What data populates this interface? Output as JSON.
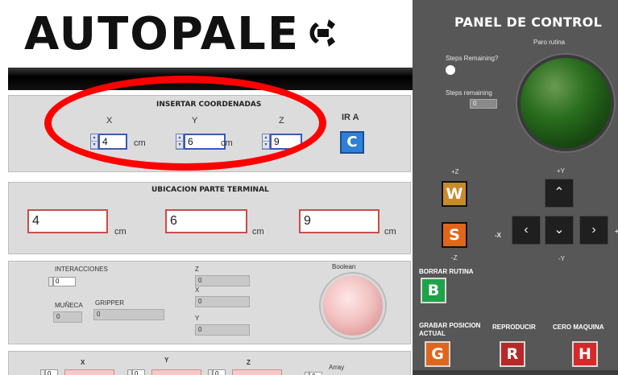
{
  "logo": {
    "text": "AUTOPALE",
    "icon": "gripper-icon"
  },
  "insert_panel": {
    "title": "INSERTAR COORDENADAS",
    "x_label": "X",
    "y_label": "Y",
    "z_label": "Z",
    "x_value": "4",
    "y_value": "6",
    "z_value": "9",
    "unit": "cm",
    "go_label": "IR A",
    "go_button": "C"
  },
  "terminal_panel": {
    "title": "UBICACION PARTE TERMINAL",
    "x_value": "4",
    "y_value": "6",
    "z_value": "9",
    "unit": "cm"
  },
  "status_panel": {
    "interacciones_label": "INTERACCIONES",
    "interacciones_value": "0",
    "muneca_label": "MUÑECA",
    "muneca_value": "0",
    "gripper_label": "GRIPPER",
    "gripper_value": "0",
    "z_label": "Z",
    "z_value": "0",
    "x_label": "X",
    "x_value": "0",
    "y_label": "Y",
    "y_value": "0",
    "boolean_label": "Boolean"
  },
  "array_panel": {
    "x_label": "X",
    "y_label": "Y",
    "z_label": "Z",
    "array_label": "Array",
    "index_value": "0"
  },
  "control_panel": {
    "title": "PANEL DE CONTROL",
    "steps_remaining_q": "Steps Remaining?",
    "steps_remaining_label": "Steps remaining",
    "steps_remaining_value": "0",
    "paro_label": "Paro rutina",
    "plus_z": "+Z",
    "minus_z": "-Z",
    "w_button": "W",
    "s_button": "S",
    "plus_y": "+Y",
    "minus_y": "-Y",
    "minus_x": "-X",
    "plus_x": "+X",
    "borrar_label": "BORRAR RUTINA",
    "b_button": "B",
    "grabar_label": "GRABAR POSICION ACTUAL",
    "g_button": "G",
    "reproducir_label": "REPRODUCIR",
    "r_button": "R",
    "cero_label": "CERO MAQUINA",
    "h_button": "H",
    "arrow_up": "⌃",
    "arrow_down": "⌄",
    "arrow_left": "‹",
    "arrow_right": "›"
  },
  "colors": {
    "panel_bg": "#575757",
    "led_green": "#2a6e1e",
    "highlight": "#ff0000",
    "ir_button": "#2e80d6"
  }
}
